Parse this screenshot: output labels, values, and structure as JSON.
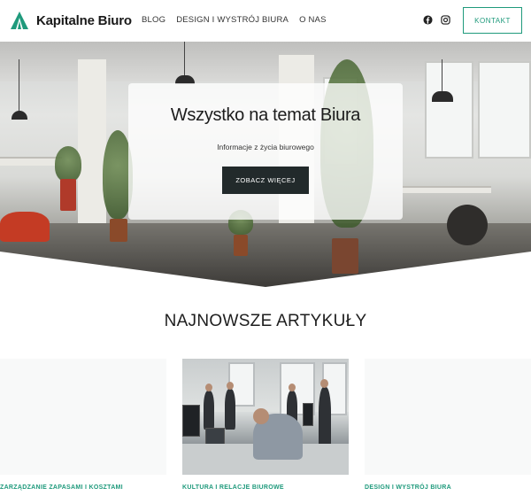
{
  "header": {
    "brand": "Kapitalne Biuro",
    "nav": [
      "BLOG",
      "DESIGN I WYSTRÓJ BIURA",
      "O NAS"
    ],
    "social_icons": [
      "facebook-icon",
      "instagram-icon"
    ],
    "contact_label": "KONTAKT",
    "accent_color": "#1f9a7c"
  },
  "hero": {
    "title": "Wszystko na temat Biura",
    "subtitle": "Informacje z życia biurowego",
    "button_label": "ZOBACZ WIĘCEJ"
  },
  "latest": {
    "title": "NAJNOWSZE ARTYKUŁY",
    "articles": [
      {
        "category": "ZARZĄDZANIE ZAPASAMI I KOSZTAMI"
      },
      {
        "category": "KULTURA I RELACJE BIUROWE"
      },
      {
        "category": "DESIGN I WYSTRÓJ BIURA"
      }
    ]
  }
}
